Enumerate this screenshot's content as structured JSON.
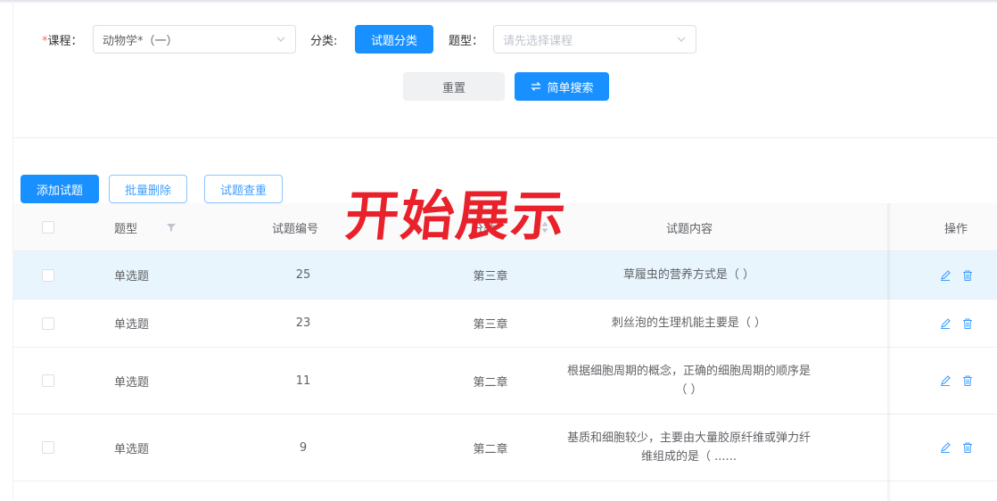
{
  "filters": {
    "course_required_mark": "*",
    "course_label": "课程：",
    "course_value": "动物学*（一）",
    "category_label": "分类:",
    "category_button": "试题分类",
    "type_label": "题型：",
    "type_placeholder": "请先选择课程"
  },
  "actions": {
    "reset": "重置",
    "simple_search": "简单搜索"
  },
  "toolbar": {
    "add": "添加试题",
    "batch_delete": "批量删除",
    "duplicate_check": "试题查重"
  },
  "overlay_text": "开始展示",
  "table": {
    "headers": {
      "type": "题型",
      "number": "试题编号",
      "category": "分类",
      "content": "试题内容",
      "ops": "操作"
    },
    "rows": [
      {
        "type": "单选题",
        "number": "25",
        "category": "第三章",
        "content": "草履虫的营养方式是（ ）"
      },
      {
        "type": "单选题",
        "number": "23",
        "category": "第三章",
        "content": "刺丝泡的生理机能主要是（ ）"
      },
      {
        "type": "单选题",
        "number": "11",
        "category": "第二章",
        "content": "根据细胞周期的概念，正确的细胞周期的顺序是（ ）"
      },
      {
        "type": "单选题",
        "number": "9",
        "category": "第二章",
        "content": "基质和细胞较少，主要由大量胶原纤维或弹力纤维组成的是（ ......"
      }
    ]
  },
  "colors": {
    "primary": "#1890ff",
    "row_highlight": "#e8f5fd",
    "required": "#f56c6c",
    "watermark": "#e8212b"
  }
}
